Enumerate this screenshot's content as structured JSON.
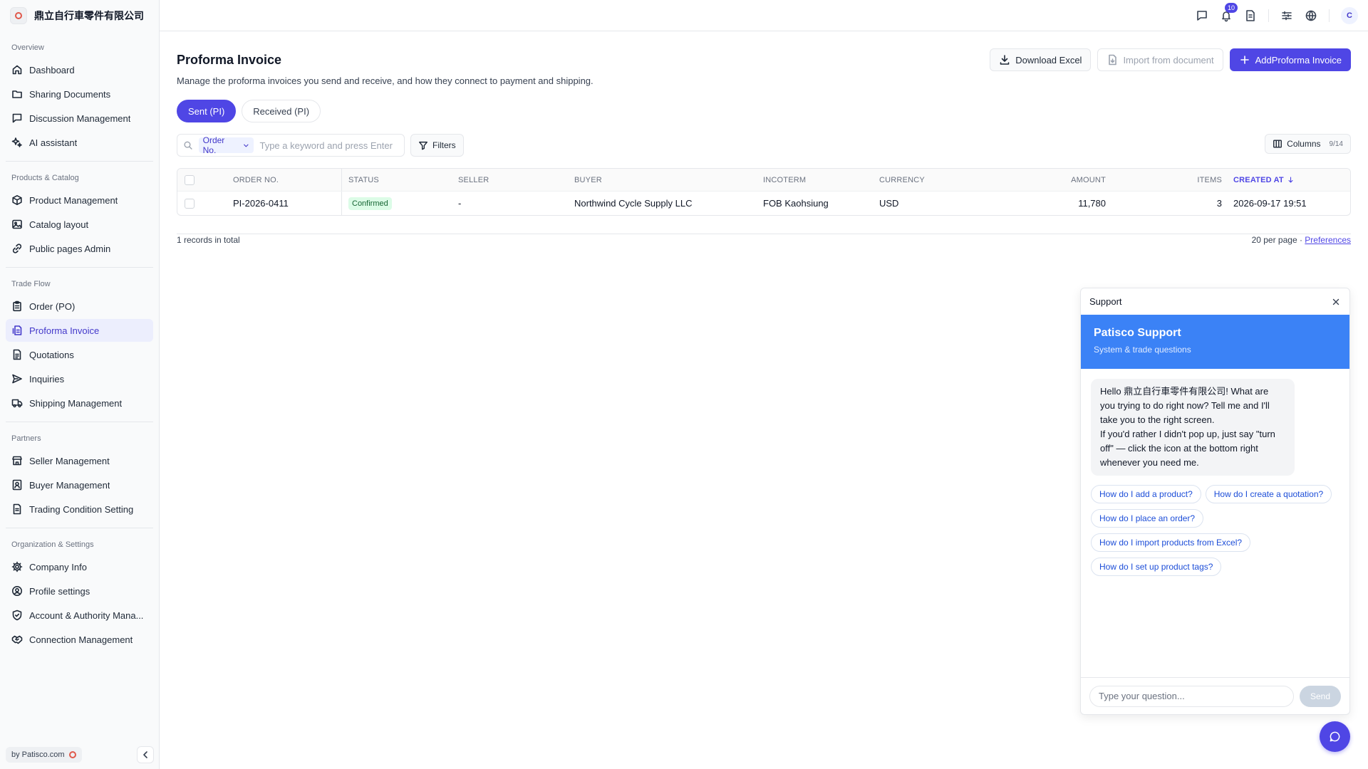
{
  "brand": {
    "name": "鼎立自行車零件有限公司"
  },
  "sidebar": {
    "groups": [
      {
        "title": "Overview",
        "items": [
          {
            "label": "Dashboard",
            "icon": "home-icon"
          },
          {
            "label": "Sharing Documents",
            "icon": "folder-icon"
          },
          {
            "label": "Discussion Management",
            "icon": "message-square-icon"
          },
          {
            "label": "AI assistant",
            "icon": "sparkles-icon"
          }
        ]
      },
      {
        "title": "Products & Catalog",
        "items": [
          {
            "label": "Product Management",
            "icon": "package-icon"
          },
          {
            "label": "Catalog layout",
            "icon": "image-icon"
          },
          {
            "label": "Public pages Admin",
            "icon": "link-icon"
          }
        ]
      },
      {
        "title": "Trade Flow",
        "items": [
          {
            "label": "Order (PO)",
            "icon": "clipboard-icon"
          },
          {
            "label": "Proforma Invoice",
            "icon": "invoice-icon",
            "active": true
          },
          {
            "label": "Quotations",
            "icon": "file-text-icon"
          },
          {
            "label": "Inquiries",
            "icon": "send-icon"
          },
          {
            "label": "Shipping Management",
            "icon": "truck-icon"
          }
        ]
      },
      {
        "title": "Partners",
        "items": [
          {
            "label": "Seller Management",
            "icon": "store-icon"
          },
          {
            "label": "Buyer Management",
            "icon": "contact-icon"
          },
          {
            "label": "Trading Condition Setting",
            "icon": "file-settings-icon"
          }
        ]
      },
      {
        "title": "Organization & Settings",
        "items": [
          {
            "label": "Company Info",
            "icon": "gear-icon"
          },
          {
            "label": "Profile settings",
            "icon": "user-circle-icon"
          },
          {
            "label": "Account & Authority Mana...",
            "icon": "shield-icon"
          },
          {
            "label": "Connection Management",
            "icon": "handshake-icon"
          }
        ]
      }
    ],
    "footer_label": "by Patisco.com"
  },
  "topbar": {
    "notification_count": "10",
    "avatar_initial": "C"
  },
  "page": {
    "title": "Proforma Invoice",
    "description": "Manage the proforma invoices you send and receive, and how they connect to payment and shipping.",
    "actions": {
      "download": "Download Excel",
      "import": "Import from document",
      "add": "AddProforma Invoice"
    },
    "tabs": {
      "sent": "Sent (PI)",
      "received": "Received (PI)"
    }
  },
  "toolbar": {
    "search_field": "Order No.",
    "search_placeholder": "Type a keyword and press Enter",
    "filters": "Filters",
    "columns": "Columns",
    "columns_count": "9/14"
  },
  "table": {
    "headers": {
      "order": "ORDER NO.",
      "status": "STATUS",
      "seller": "SELLER",
      "buyer": "BUYER",
      "incoterm": "INCOTERM",
      "currency": "CURRENCY",
      "amount": "AMOUNT",
      "items": "ITEMS",
      "created": "CREATED AT"
    },
    "rows": [
      {
        "order": "PI-2026-0411",
        "status": "Confirmed",
        "seller": "-",
        "buyer": "Northwind Cycle Supply LLC",
        "incoterm": "FOB Kaohsiung",
        "currency": "USD",
        "amount": "11,780",
        "items": "3",
        "created": "2026-09-17 19:51"
      }
    ],
    "total_label": "1 records in total",
    "per_page": "20 per page",
    "preferences": "Preferences"
  },
  "support": {
    "header": "Support",
    "hero_title": "Patisco Support",
    "hero_subtitle": "System & trade questions",
    "message": "Hello 鼎立自行車零件有限公司! What are you trying to do right now? Tell me and I'll take you to the right screen.\nIf you'd rather I didn't pop up, just say \"turn off\" — click the icon at the bottom right whenever you need me.",
    "chips": [
      "How do I add a product?",
      "How do I create a quotation?",
      "How do I place an order?",
      "How do I import products from Excel?",
      "How do I set up product tags?"
    ],
    "input_placeholder": "Type your question...",
    "send": "Send"
  }
}
